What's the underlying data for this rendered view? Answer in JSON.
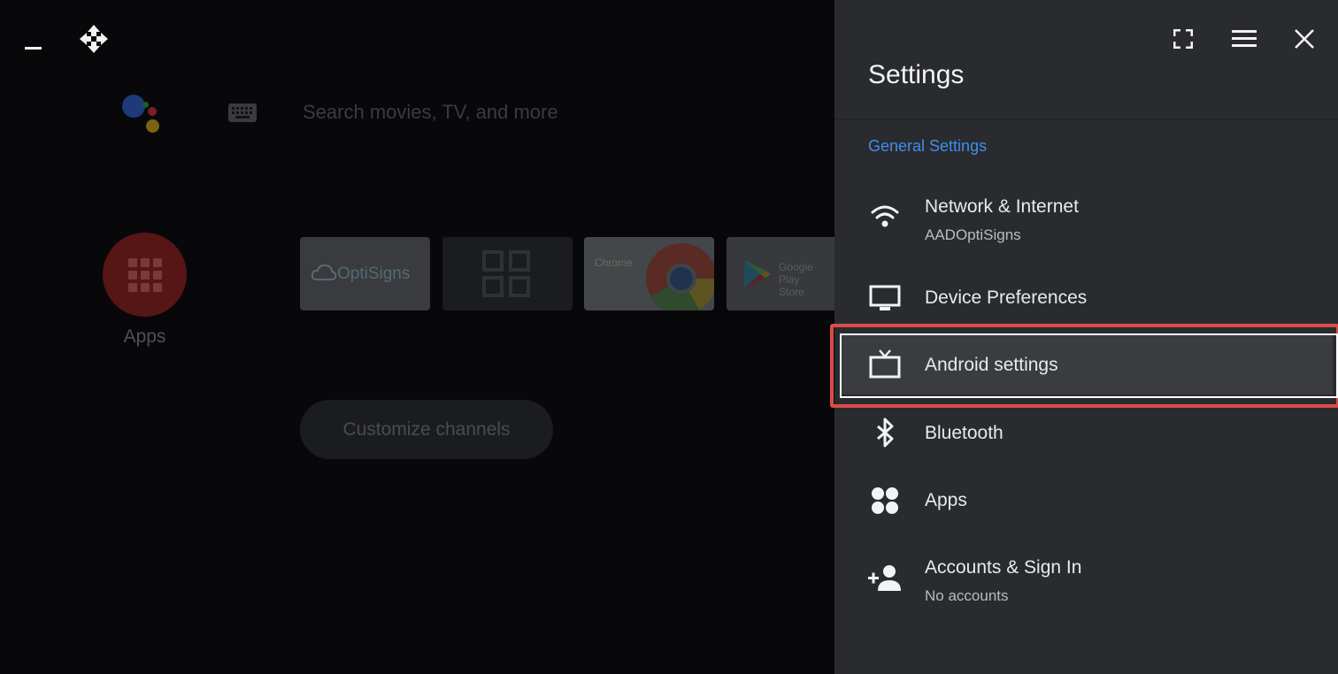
{
  "home": {
    "search_placeholder": "Search movies, TV, and more",
    "apps_label": "Apps",
    "tiles": {
      "optisigns": "OptiSigns",
      "chrome": "Chrome",
      "play_line1": "Google Play",
      "play_line2": "Store"
    },
    "customize_label": "Customize channels"
  },
  "settings": {
    "title": "Settings",
    "section": "General Settings",
    "items": [
      {
        "title": "Network & Internet",
        "subtitle": "AADOptiSigns",
        "icon": "wifi-icon"
      },
      {
        "title": "Device Preferences",
        "icon": "monitor-icon"
      },
      {
        "title": "Android settings",
        "icon": "tv-icon",
        "focused": true
      },
      {
        "title": "Bluetooth",
        "icon": "bluetooth-icon"
      },
      {
        "title": "Apps",
        "icon": "apps-dots-icon"
      },
      {
        "title": "Accounts & Sign In",
        "subtitle": "No accounts",
        "icon": "add-person-icon"
      }
    ]
  },
  "colors": {
    "accent": "#3d8ef0",
    "panel_bg": "#2a2b2e",
    "highlight_border": "#dd4b4b",
    "home_bg": "#08080b"
  }
}
